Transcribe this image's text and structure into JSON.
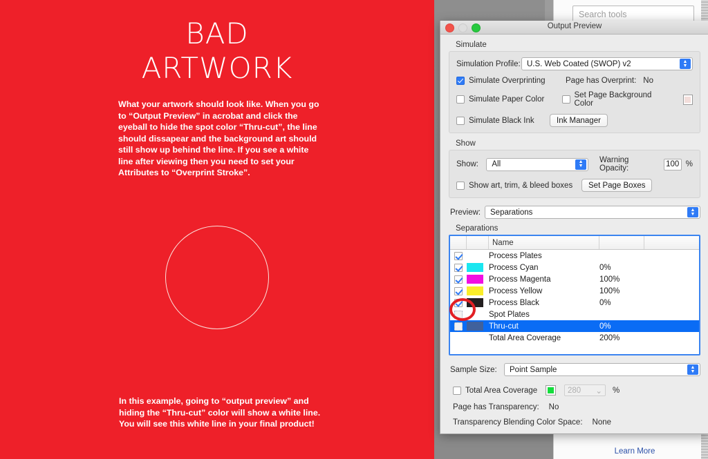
{
  "artwork": {
    "background_color": "#ee2029",
    "title_line1": "BAD",
    "title_line2": "ARTWORK",
    "paragraph_top": "What your artwork should look like. When you go to “Output Preview” in acrobat and click the eyeball to hide the spot color “Thru-cut”, the line should dissapear and the background art should still show up behind the line. If you see a white line after viewing then you need to set your Attributes to “Overprint Stroke”.",
    "paragraph_bottom": "In this example, going to “output preview” and hiding the “Thru-cut” color will show a white line. You will see this white line in your final product!",
    "circle_stroke_color": "#fbe3dd"
  },
  "app_background": {
    "search_placeholder": "Search tools",
    "learn_more_label": "Learn More"
  },
  "dialog": {
    "title": "Output Preview",
    "window_buttons": {
      "close": "close-button",
      "minimize": "minimize-button",
      "zoom": "zoom-button"
    },
    "simulate": {
      "section_label": "Simulate",
      "profile_label": "Simulation Profile:",
      "profile_value": "U.S. Web Coated (SWOP) v2",
      "simulate_overprinting_label": "Simulate Overprinting",
      "simulate_overprinting_checked": true,
      "page_has_overprint_label": "Page has Overprint:",
      "page_has_overprint_value": "No",
      "simulate_paper_color_label": "Simulate Paper Color",
      "simulate_paper_color_checked": false,
      "set_page_background_color_label": "Set Page Background Color",
      "set_page_background_color_checked": false,
      "page_background_swatch": "#f3dedb",
      "simulate_black_ink_label": "Simulate Black Ink",
      "simulate_black_ink_checked": false,
      "ink_manager_label": "Ink Manager"
    },
    "show": {
      "section_label": "Show",
      "show_label": "Show:",
      "show_value": "All",
      "warning_opacity_label": "Warning Opacity:",
      "warning_opacity_value": "100",
      "percent_symbol": "%",
      "show_boxes_label": "Show art, trim, & bleed boxes",
      "show_boxes_checked": false,
      "set_page_boxes_label": "Set Page Boxes"
    },
    "preview": {
      "preview_label": "Preview:",
      "preview_value": "Separations"
    },
    "separations": {
      "section_label": "Separations",
      "column_header_name": "Name",
      "rows": [
        {
          "checked": true,
          "swatch": null,
          "name": "Process Plates",
          "pct": "",
          "selected": false
        },
        {
          "checked": true,
          "swatch": "#1ae6f0",
          "name": "Process Cyan",
          "pct": "0%",
          "selected": false
        },
        {
          "checked": true,
          "swatch": "#f20fe2",
          "name": "Process Magenta",
          "pct": "100%",
          "selected": false
        },
        {
          "checked": true,
          "swatch": "#fbee2a",
          "name": "Process Yellow",
          "pct": "100%",
          "selected": false
        },
        {
          "checked": true,
          "swatch": "#231f20",
          "name": "Process Black",
          "pct": "0%",
          "selected": false
        },
        {
          "checked": false,
          "swatch": null,
          "name": "Spot Plates",
          "pct": "",
          "selected": false
        },
        {
          "checked": false,
          "swatch": "#40619c",
          "name": "Thru-cut",
          "pct": "0%",
          "selected": true
        },
        {
          "checked": null,
          "swatch": null,
          "name": "Total Area Coverage",
          "pct": "200%",
          "selected": false
        }
      ]
    },
    "bottom": {
      "sample_size_label": "Sample Size:",
      "sample_size_value": "Point Sample",
      "total_area_coverage_label": "Total Area Coverage",
      "total_area_coverage_checked": false,
      "tac_swatch": "#14dd3c",
      "tac_value": "280",
      "percent_symbol": "%",
      "page_has_transparency_label": "Page has Transparency:",
      "page_has_transparency_value": "No",
      "blending_space_label": "Transparency Blending Color Space:",
      "blending_space_value": "None"
    }
  },
  "annotation": {
    "oval_color": "#e21f24",
    "target": "thru-cut-checkbox"
  }
}
